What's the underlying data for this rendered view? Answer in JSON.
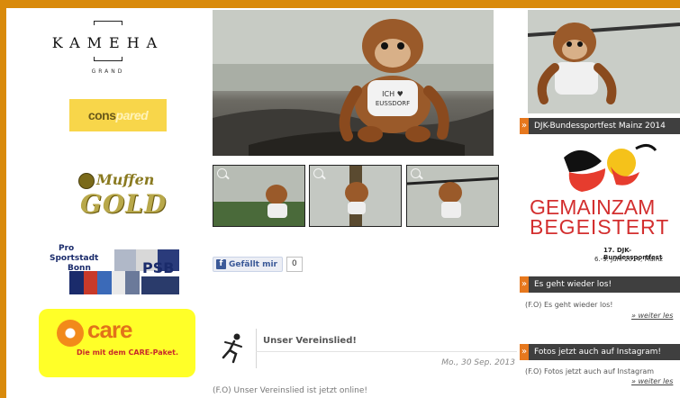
{
  "sponsors": {
    "kameha": {
      "name": "KAMEHA",
      "sub": "GRAND"
    },
    "conspared": {
      "part1": "cons",
      "part2": "pared"
    },
    "muffen": {
      "top": "Muffen",
      "bottom": "GOLD"
    },
    "psb": {
      "line1": "Pro",
      "line2": "Sportstadt",
      "line3": "Bonn",
      "abbr": "PSB"
    },
    "care": {
      "name": "care",
      "sub": "Die mit dem CARE-Paket."
    }
  },
  "facebook": {
    "like_label": "Gefällt mir",
    "count": "0",
    "icon": "facebook-icon"
  },
  "article": {
    "title": "Unser Vereinslied!",
    "date": "Mo., 30 Sep. 2013",
    "teaser": "(F.O) Unser Vereinslied ist jetzt online!",
    "icon": "runner-icon"
  },
  "sidebar": {
    "djk_heading": "DJK-Bundessportfest Mainz 2014",
    "djk_logo": {
      "line1": "GEMAINZAM",
      "line2": "BEGEISTERT",
      "event": "17. DJK-Bundessportfest",
      "dates": "6.-9. Juni 2014, Mainz"
    },
    "news1": {
      "heading": "Es geht wieder los!",
      "text": "(F.O) Es geht wieder los!",
      "more": "» weiter les"
    },
    "news2": {
      "heading": "Fotos jetzt auch auf Instagram!",
      "text": "(F.O) Fotos jetzt auch auf Instagram",
      "more": "» weiter les"
    }
  },
  "colors": {
    "page_bg": "#d98a0b",
    "heading_bg": "#3f3f3f",
    "accent": "#e6781e",
    "fb_blue": "#3b5998"
  }
}
